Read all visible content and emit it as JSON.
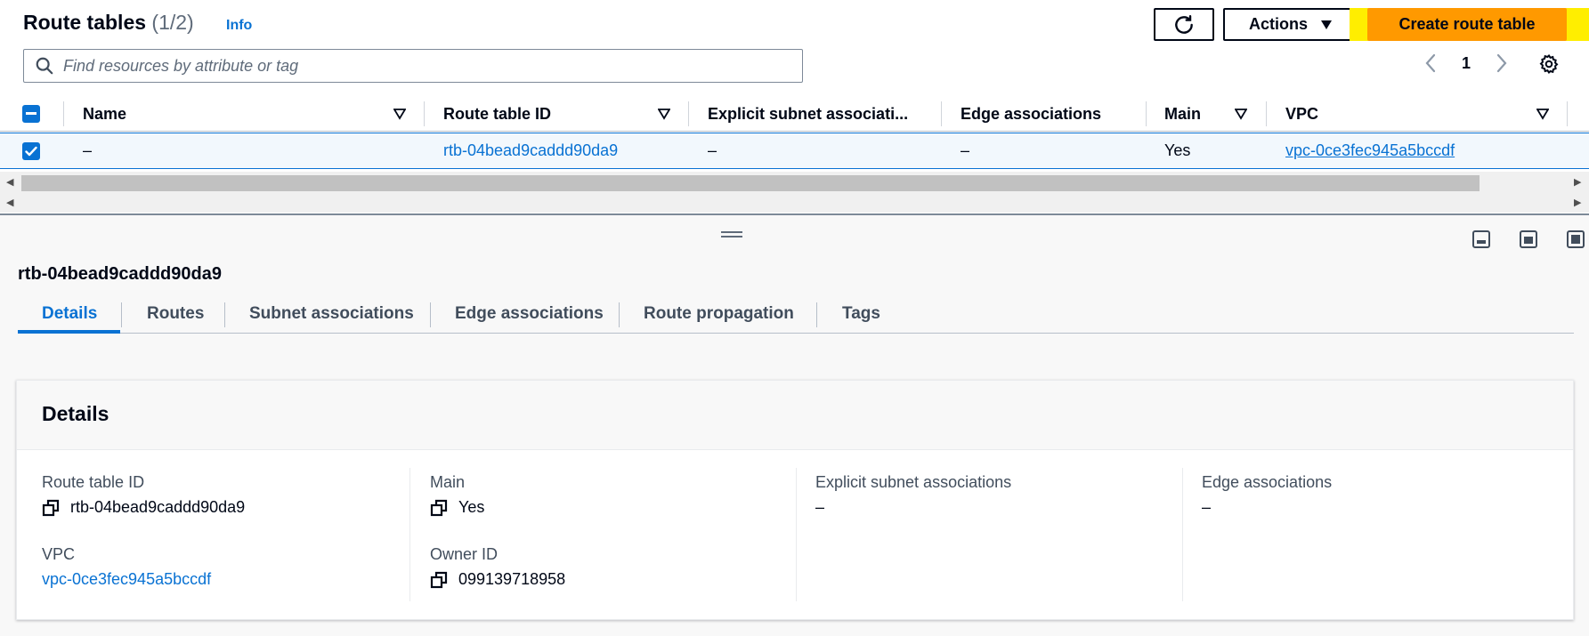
{
  "header": {
    "title": "Route tables",
    "count": "(1/2)",
    "info": "Info",
    "actions_label": "Actions",
    "create_label": "Create route table"
  },
  "search": {
    "placeholder": "Find resources by attribute or tag"
  },
  "pagination": {
    "current_page": "1"
  },
  "table": {
    "columns": [
      "Name",
      "Route table ID",
      "Explicit subnet associati...",
      "Edge associations",
      "Main",
      "VPC"
    ],
    "rows": [
      {
        "name": "–",
        "route_table_id": "rtb-04bead9caddd90da9",
        "explicit_subnet": "–",
        "edge": "–",
        "main": "Yes",
        "vpc": "vpc-0ce3fec945a5bccdf"
      }
    ]
  },
  "detail": {
    "title": "rtb-04bead9caddd90da9",
    "tabs": [
      "Details",
      "Routes",
      "Subnet associations",
      "Edge associations",
      "Route propagation",
      "Tags"
    ],
    "active_tab": "Details",
    "card_title": "Details",
    "fields": {
      "route_table_id_label": "Route table ID",
      "route_table_id_value": "rtb-04bead9caddd90da9",
      "vpc_label": "VPC",
      "vpc_value": "vpc-0ce3fec945a5bccdf",
      "main_label": "Main",
      "main_value": "Yes",
      "owner_label": "Owner ID",
      "owner_value": "099139718958",
      "explicit_label": "Explicit subnet associations",
      "explicit_value": "–",
      "edge_label": "Edge associations",
      "edge_value": "–"
    }
  },
  "colors": {
    "accent": "#0972d3",
    "primary_button": "#ff9900",
    "highlight": "#ffee00",
    "text": "#000716"
  }
}
